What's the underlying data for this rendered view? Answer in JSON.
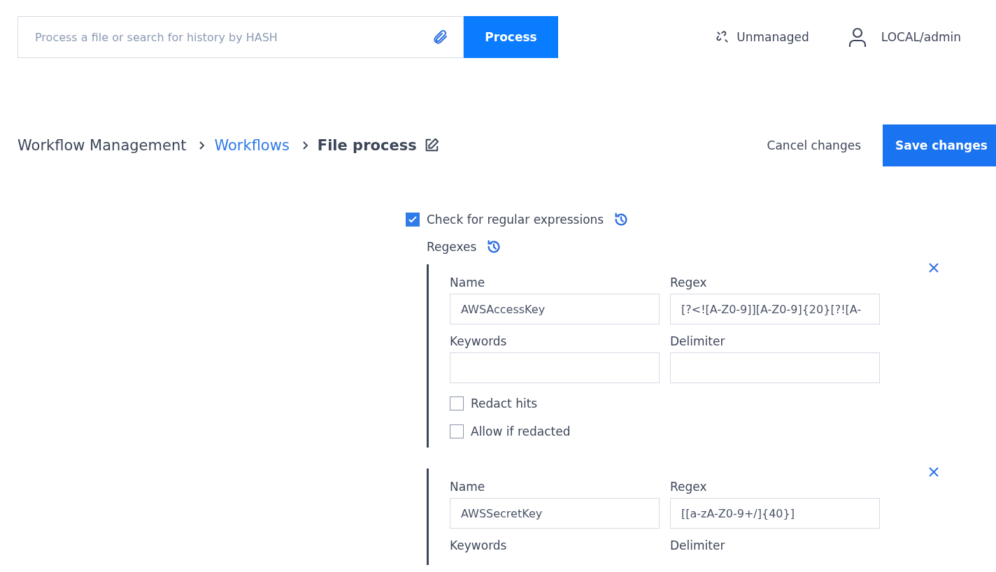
{
  "search": {
    "placeholder": "Process a file or search for history by HASH",
    "button": "Process"
  },
  "header": {
    "status": "Unmanaged",
    "user": "LOCAL/admin"
  },
  "breadcrumb": [
    {
      "label": "Workflow Management",
      "kind": "plain"
    },
    {
      "label": "Workflows",
      "kind": "link"
    },
    {
      "label": "File process",
      "kind": "current"
    }
  ],
  "actions": {
    "cancel": "Cancel changes",
    "save": "Save changes"
  },
  "regex_check": {
    "label": "Check for regular expressions",
    "checked": true
  },
  "regexes_label": "Regexes",
  "regexes": [
    {
      "fields": [
        {
          "label": "Name",
          "kind": "input",
          "value": "AWSAccessKey"
        },
        {
          "label": "Regex",
          "kind": "input",
          "value": "[?<![A-Z0-9]][A-Z0-9]{20}[?![A-"
        },
        {
          "label": "Keywords",
          "kind": "input"
        },
        {
          "label": "Delimiter",
          "kind": "input"
        }
      ],
      "options": [
        {
          "label": "Redact hits",
          "checked": false
        },
        {
          "label": "Allow if redacted",
          "checked": false
        }
      ]
    },
    {
      "fields": [
        {
          "label": "Name",
          "kind": "input",
          "value": "AWSSecretKey"
        },
        {
          "label": "Regex",
          "kind": "input",
          "value": "[[a-zA-Z0-9+/]{40}]"
        },
        {
          "label": "Keywords",
          "kind": "cut"
        },
        {
          "label": "Delimiter",
          "kind": "cut"
        }
      ]
    }
  ]
}
